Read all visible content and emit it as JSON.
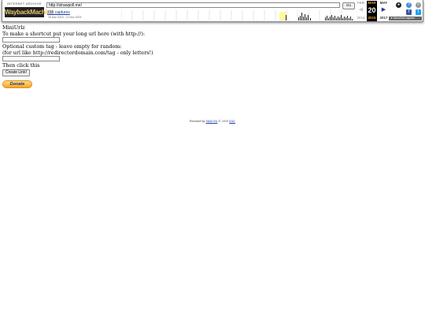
{
  "toolbar": {
    "logo_top": "INTERNET ARCHIVE",
    "logo_main": "WaybackMachine",
    "url_value": "http://strawpoll.me/",
    "go_label": "Go",
    "captures_label": "155 captures",
    "date_range": "25 Mar 2015 - 11 Nov 2023",
    "months": {
      "prev": {
        "name": "FEB",
        "day": "",
        "year": "2014"
      },
      "current": {
        "name": "MAR",
        "day": "20",
        "year": "2015"
      },
      "next": {
        "name": "MAY",
        "day": "",
        "year": "2017"
      }
    },
    "about_label": "About this capture",
    "colors": {
      "accent": "#f9a72b",
      "link": "#1a3aa5"
    }
  },
  "page": {
    "logo_alt": "MiniUrlz",
    "prompt_url": "To make a shortcut put your long url here (with http://):",
    "prompt_tag": "Optional custom tag - leave empty for random:",
    "prompt_tag_hint": "(for url like http://redirectordomain.com/tag - only letters!)",
    "then_click": "Then click this",
    "create_button": "Create Link!",
    "donate_button": "Donate"
  },
  "footer": {
    "prefix": "Powered by",
    "link1": "MiniUrlz",
    "middle": "© 2010",
    "link2": "Kin1"
  }
}
